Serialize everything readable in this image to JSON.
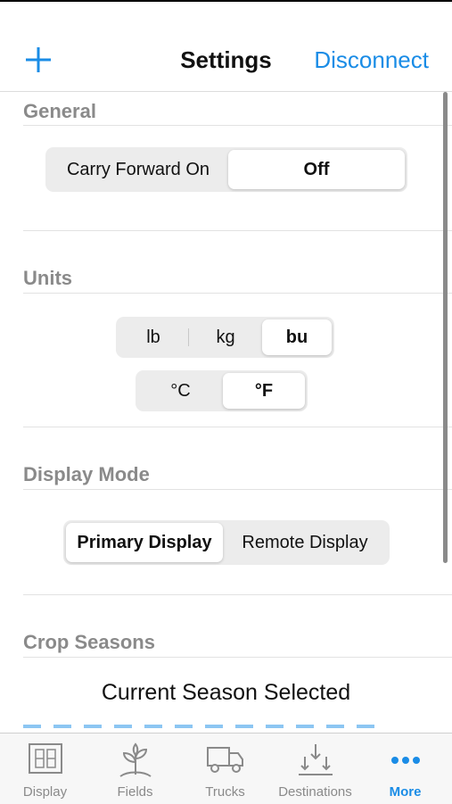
{
  "navbar": {
    "title": "Settings",
    "right_action": "Disconnect",
    "left_icon": "plus-icon",
    "accent_color": "#1a8ce6"
  },
  "sections": {
    "general": {
      "header": "General",
      "carry_forward": {
        "on_label": "Carry Forward On",
        "off_label": "Off",
        "selected": "Off"
      }
    },
    "units": {
      "header": "Units",
      "weight": {
        "options": [
          "lb",
          "kg",
          "bu"
        ],
        "selected": "bu"
      },
      "temperature": {
        "options": [
          "°C",
          "°F"
        ],
        "selected": "°F"
      }
    },
    "display_mode": {
      "header": "Display Mode",
      "options": [
        "Primary Display",
        "Remote Display"
      ],
      "selected": "Primary Display"
    },
    "crop_seasons": {
      "header": "Crop Seasons",
      "current": "Current Season Selected"
    }
  },
  "tabbar": {
    "active": "More",
    "items": [
      {
        "label": "Display",
        "icon": "display-icon"
      },
      {
        "label": "Fields",
        "icon": "plant-icon"
      },
      {
        "label": "Trucks",
        "icon": "truck-icon"
      },
      {
        "label": "Destinations",
        "icon": "unload-arrows-icon"
      },
      {
        "label": "More",
        "icon": "more-dots-icon"
      }
    ]
  }
}
